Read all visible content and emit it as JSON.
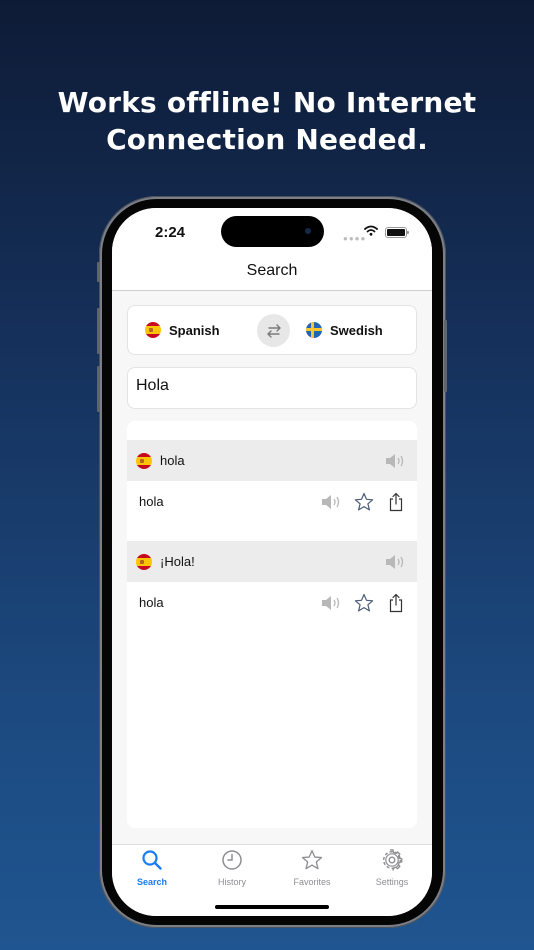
{
  "promo": {
    "headline_line1": "Works offline! No Internet",
    "headline_line2": "Connection Needed."
  },
  "status_bar": {
    "time": "2:24",
    "signal_icon": "cellular-dots-icon",
    "wifi_icon": "wifi-icon",
    "battery_icon": "battery-icon"
  },
  "nav": {
    "title": "Search"
  },
  "language_selector": {
    "source": {
      "label": "Spanish",
      "flag": "spain-flag-icon"
    },
    "swap_icon": "swap-arrows-icon",
    "target": {
      "label": "Swedish",
      "flag": "sweden-flag-icon"
    }
  },
  "search": {
    "value": "Hola",
    "placeholder": ""
  },
  "results": [
    {
      "source_word": "hola",
      "source_flag": "spain-flag-icon",
      "translation": "hola"
    },
    {
      "source_word": "¡Hola!",
      "source_flag": "spain-flag-icon",
      "translation": "hola"
    }
  ],
  "tab_bar": {
    "tabs": [
      {
        "label": "Search",
        "icon": "magnifier-icon",
        "active": true
      },
      {
        "label": "History",
        "icon": "clock-icon",
        "active": false
      },
      {
        "label": "Favorites",
        "icon": "star-icon",
        "active": false
      },
      {
        "label": "Settings",
        "icon": "gear-icon",
        "active": false
      }
    ]
  },
  "colors": {
    "accent": "#1a7cf5",
    "inactive_tab": "#8e8e93",
    "result_header_bg": "#ececec"
  }
}
